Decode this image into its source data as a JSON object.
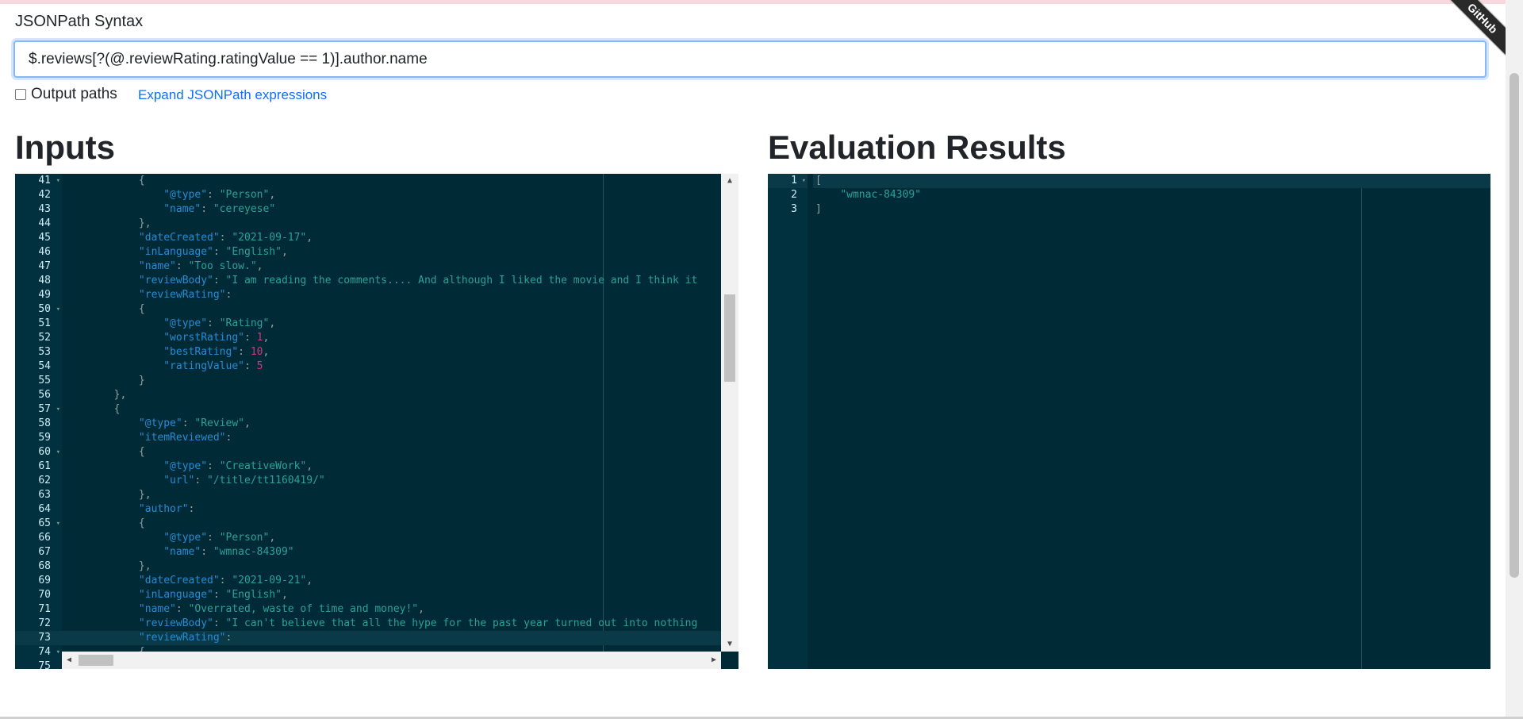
{
  "ribbon": {
    "label": "GitHub"
  },
  "query": {
    "label": "JSONPath Syntax",
    "value": "$.reviews[?(@.reviewRating.ratingValue == 1)].author.name"
  },
  "options": {
    "output_paths_label": "Output paths",
    "output_paths_checked": false,
    "expand_link": "Expand JSONPath expressions"
  },
  "inputs": {
    "title": "Inputs",
    "active_line": 73,
    "lines": [
      {
        "n": 41,
        "fold": true,
        "tokens": [
          [
            "p",
            "            {"
          ]
        ]
      },
      {
        "n": 42,
        "tokens": [
          [
            "p",
            "                "
          ],
          [
            "k",
            "\"@type\""
          ],
          [
            "p",
            ": "
          ],
          [
            "s",
            "\"Person\""
          ],
          [
            "p",
            ","
          ]
        ]
      },
      {
        "n": 43,
        "tokens": [
          [
            "p",
            "                "
          ],
          [
            "k",
            "\"name\""
          ],
          [
            "p",
            ": "
          ],
          [
            "s",
            "\"cereyese\""
          ]
        ]
      },
      {
        "n": 44,
        "tokens": [
          [
            "p",
            "            },"
          ]
        ]
      },
      {
        "n": 45,
        "tokens": [
          [
            "p",
            "            "
          ],
          [
            "k",
            "\"dateCreated\""
          ],
          [
            "p",
            ": "
          ],
          [
            "s",
            "\"2021-09-17\""
          ],
          [
            "p",
            ","
          ]
        ]
      },
      {
        "n": 46,
        "tokens": [
          [
            "p",
            "            "
          ],
          [
            "k",
            "\"inLanguage\""
          ],
          [
            "p",
            ": "
          ],
          [
            "s",
            "\"English\""
          ],
          [
            "p",
            ","
          ]
        ]
      },
      {
        "n": 47,
        "tokens": [
          [
            "p",
            "            "
          ],
          [
            "k",
            "\"name\""
          ],
          [
            "p",
            ": "
          ],
          [
            "s",
            "\"Too slow.\""
          ],
          [
            "p",
            ","
          ]
        ]
      },
      {
        "n": 48,
        "tokens": [
          [
            "p",
            "            "
          ],
          [
            "k",
            "\"reviewBody\""
          ],
          [
            "p",
            ": "
          ],
          [
            "s",
            "\"I am reading the comments.... And although I liked the movie and I think it"
          ]
        ]
      },
      {
        "n": 49,
        "tokens": [
          [
            "p",
            "            "
          ],
          [
            "k",
            "\"reviewRating\""
          ],
          [
            "p",
            ":"
          ]
        ]
      },
      {
        "n": 50,
        "fold": true,
        "tokens": [
          [
            "p",
            "            {"
          ]
        ]
      },
      {
        "n": 51,
        "tokens": [
          [
            "p",
            "                "
          ],
          [
            "k",
            "\"@type\""
          ],
          [
            "p",
            ": "
          ],
          [
            "s",
            "\"Rating\""
          ],
          [
            "p",
            ","
          ]
        ]
      },
      {
        "n": 52,
        "tokens": [
          [
            "p",
            "                "
          ],
          [
            "k",
            "\"worstRating\""
          ],
          [
            "p",
            ": "
          ],
          [
            "n",
            "1"
          ],
          [
            "p",
            ","
          ]
        ]
      },
      {
        "n": 53,
        "tokens": [
          [
            "p",
            "                "
          ],
          [
            "k",
            "\"bestRating\""
          ],
          [
            "p",
            ": "
          ],
          [
            "n",
            "10"
          ],
          [
            "p",
            ","
          ]
        ]
      },
      {
        "n": 54,
        "tokens": [
          [
            "p",
            "                "
          ],
          [
            "k",
            "\"ratingValue\""
          ],
          [
            "p",
            ": "
          ],
          [
            "n",
            "5"
          ]
        ]
      },
      {
        "n": 55,
        "tokens": [
          [
            "p",
            "            }"
          ]
        ]
      },
      {
        "n": 56,
        "tokens": [
          [
            "p",
            "        },"
          ]
        ]
      },
      {
        "n": 57,
        "fold": true,
        "tokens": [
          [
            "p",
            "        {"
          ]
        ]
      },
      {
        "n": 58,
        "tokens": [
          [
            "p",
            "            "
          ],
          [
            "k",
            "\"@type\""
          ],
          [
            "p",
            ": "
          ],
          [
            "s",
            "\"Review\""
          ],
          [
            "p",
            ","
          ]
        ]
      },
      {
        "n": 59,
        "tokens": [
          [
            "p",
            "            "
          ],
          [
            "k",
            "\"itemReviewed\""
          ],
          [
            "p",
            ":"
          ]
        ]
      },
      {
        "n": 60,
        "fold": true,
        "tokens": [
          [
            "p",
            "            {"
          ]
        ]
      },
      {
        "n": 61,
        "tokens": [
          [
            "p",
            "                "
          ],
          [
            "k",
            "\"@type\""
          ],
          [
            "p",
            ": "
          ],
          [
            "s",
            "\"CreativeWork\""
          ],
          [
            "p",
            ","
          ]
        ]
      },
      {
        "n": 62,
        "tokens": [
          [
            "p",
            "                "
          ],
          [
            "k",
            "\"url\""
          ],
          [
            "p",
            ": "
          ],
          [
            "s",
            "\"/title/tt1160419/\""
          ]
        ]
      },
      {
        "n": 63,
        "tokens": [
          [
            "p",
            "            },"
          ]
        ]
      },
      {
        "n": 64,
        "tokens": [
          [
            "p",
            "            "
          ],
          [
            "k",
            "\"author\""
          ],
          [
            "p",
            ":"
          ]
        ]
      },
      {
        "n": 65,
        "fold": true,
        "tokens": [
          [
            "p",
            "            {"
          ]
        ]
      },
      {
        "n": 66,
        "tokens": [
          [
            "p",
            "                "
          ],
          [
            "k",
            "\"@type\""
          ],
          [
            "p",
            ": "
          ],
          [
            "s",
            "\"Person\""
          ],
          [
            "p",
            ","
          ]
        ]
      },
      {
        "n": 67,
        "tokens": [
          [
            "p",
            "                "
          ],
          [
            "k",
            "\"name\""
          ],
          [
            "p",
            ": "
          ],
          [
            "s",
            "\"wmnac-84309\""
          ]
        ]
      },
      {
        "n": 68,
        "tokens": [
          [
            "p",
            "            },"
          ]
        ]
      },
      {
        "n": 69,
        "tokens": [
          [
            "p",
            "            "
          ],
          [
            "k",
            "\"dateCreated\""
          ],
          [
            "p",
            ": "
          ],
          [
            "s",
            "\"2021-09-21\""
          ],
          [
            "p",
            ","
          ]
        ]
      },
      {
        "n": 70,
        "tokens": [
          [
            "p",
            "            "
          ],
          [
            "k",
            "\"inLanguage\""
          ],
          [
            "p",
            ": "
          ],
          [
            "s",
            "\"English\""
          ],
          [
            "p",
            ","
          ]
        ]
      },
      {
        "n": 71,
        "tokens": [
          [
            "p",
            "            "
          ],
          [
            "k",
            "\"name\""
          ],
          [
            "p",
            ": "
          ],
          [
            "s",
            "\"Overrated, waste of time and money!\""
          ],
          [
            "p",
            ","
          ]
        ]
      },
      {
        "n": 72,
        "tokens": [
          [
            "p",
            "            "
          ],
          [
            "k",
            "\"reviewBody\""
          ],
          [
            "p",
            ": "
          ],
          [
            "s",
            "\"I can't believe that all the hype for the past year turned out into nothing"
          ]
        ]
      },
      {
        "n": 73,
        "tokens": [
          [
            "p",
            "            "
          ],
          [
            "k",
            "\"reviewRating\""
          ],
          [
            "p",
            ":"
          ]
        ]
      },
      {
        "n": 74,
        "fold": true,
        "tokens": [
          [
            "p",
            "            {"
          ]
        ]
      },
      {
        "n": 75,
        "tokens": []
      }
    ]
  },
  "results": {
    "title": "Evaluation Results",
    "active_line": 1,
    "lines": [
      {
        "n": 1,
        "fold": true,
        "tokens": [
          [
            "p",
            "["
          ]
        ]
      },
      {
        "n": 2,
        "tokens": [
          [
            "p",
            "    "
          ],
          [
            "s",
            "\"wmnac-84309\""
          ]
        ]
      },
      {
        "n": 3,
        "tokens": [
          [
            "p",
            "]"
          ]
        ]
      }
    ]
  },
  "icons": {
    "fold": "fold-arrow-icon",
    "scroll_up": "scroll-up-icon",
    "scroll_down": "scroll-down-icon",
    "scroll_left": "scroll-left-icon",
    "scroll_right": "scroll-right-icon"
  },
  "colors": {
    "editor_bg": "#002b36",
    "key": "#268bd2",
    "string": "#2aa198",
    "number": "#d33682",
    "link": "#0d6efd"
  }
}
